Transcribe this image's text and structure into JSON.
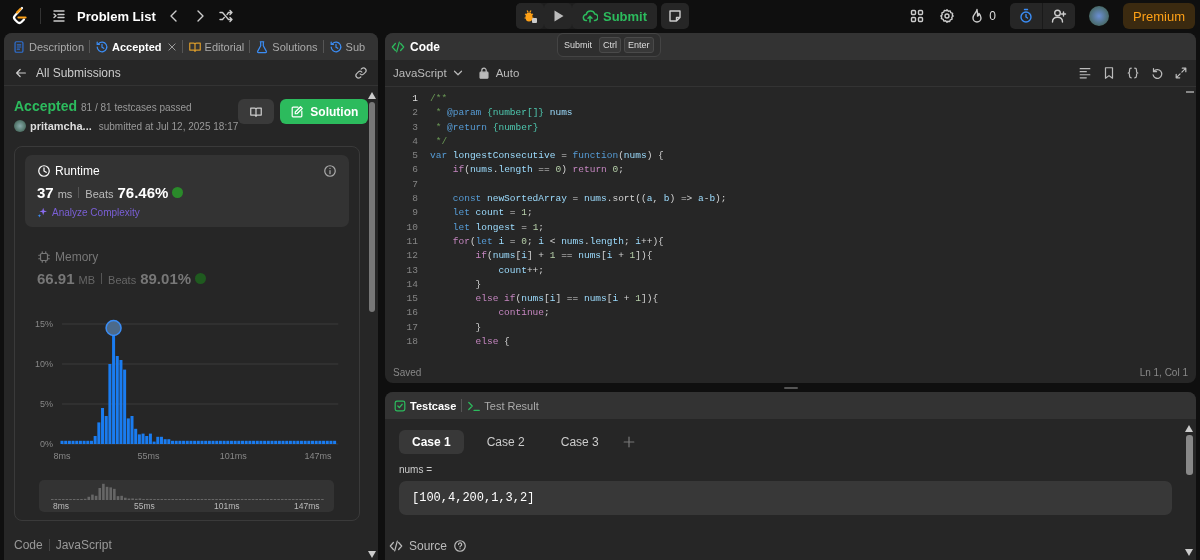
{
  "top_bar": {
    "problem_list": "Problem List",
    "submit": "Submit",
    "tooltip": {
      "label": "Submit",
      "keys": [
        "Ctrl",
        "Enter"
      ]
    },
    "streak": "0",
    "premium": "Premium"
  },
  "left_panel": {
    "tabs": [
      {
        "label": "Description",
        "kind": "document",
        "selected": false,
        "closable": false
      },
      {
        "label": "Accepted",
        "kind": "history",
        "selected": true,
        "closable": true
      },
      {
        "label": "Editorial",
        "kind": "book",
        "selected": false,
        "closable": false
      },
      {
        "label": "Solutions",
        "kind": "flask",
        "selected": false,
        "closable": false
      },
      {
        "label": "Sub",
        "kind": "history",
        "selected": false,
        "closable": false
      }
    ],
    "back_link": "All Submissions",
    "submission": {
      "status": "Accepted",
      "testcases": "81 / 81 testcases passed",
      "user": "pritamcha...",
      "submitted": "submitted at Jul 12, 2025 18:17",
      "solution_button": "Solution"
    },
    "metrics": [
      {
        "kind": "runtime",
        "title": "Runtime",
        "value": "37",
        "unit": "ms",
        "beats_label": "Beats",
        "beats": "76.46%",
        "link": "Analyze Complexity",
        "selected": true
      },
      {
        "kind": "memory",
        "title": "Memory",
        "value": "66.91",
        "unit": "MB",
        "beats_label": "Beats",
        "beats": "89.01%",
        "selected": false
      }
    ],
    "chart_data": {
      "type": "bar",
      "x": [
        8,
        10,
        12,
        14,
        16,
        18,
        20,
        22,
        24,
        26,
        28,
        30,
        32,
        34,
        36,
        38,
        40,
        42,
        44,
        46,
        48,
        50,
        52,
        54,
        56,
        58,
        60,
        62,
        64,
        66,
        68,
        70,
        72,
        74,
        76,
        78,
        80,
        82,
        84,
        86,
        88,
        90,
        92,
        94,
        96,
        98,
        100,
        102,
        104,
        106,
        108,
        110,
        112,
        114,
        116,
        118,
        120,
        122,
        124,
        126,
        128,
        130,
        132,
        134,
        136,
        138,
        140,
        142,
        144,
        146,
        148,
        150,
        152,
        154,
        156
      ],
      "values": [
        0.4,
        0.4,
        0.4,
        0.4,
        0.4,
        0.4,
        0.4,
        0.4,
        0.4,
        1.0,
        2.7,
        4.5,
        3.5,
        10,
        13.5,
        11,
        10.5,
        9.3,
        3.2,
        3.5,
        1.9,
        1.2,
        1.3,
        1.0,
        1.3,
        0.3,
        0.9,
        0.9,
        0.6,
        0.6,
        0.4,
        0.4,
        0.4,
        0.4,
        0.4,
        0.4,
        0.4,
        0.4,
        0.4,
        0.4,
        0.4,
        0.4,
        0.4,
        0.4,
        0.4,
        0.4,
        0.4,
        0.4,
        0.4,
        0.4,
        0.4,
        0.4,
        0.4,
        0.4,
        0.4,
        0.4,
        0.4,
        0.4,
        0.4,
        0.4,
        0.4,
        0.4,
        0.4,
        0.4,
        0.4,
        0.4,
        0.4,
        0.4,
        0.4,
        0.4,
        0.4,
        0.4,
        0.4,
        0.4,
        0.4
      ],
      "ylim": [
        0,
        15
      ],
      "xlim": [
        8,
        158
      ],
      "yticks": [
        {
          "value": 0,
          "label": "0%"
        },
        {
          "value": 5,
          "label": "5%"
        },
        {
          "value": 10,
          "label": "10%"
        },
        {
          "value": 15,
          "label": "15%"
        }
      ],
      "xticks": [
        {
          "value": 8,
          "label": "8ms"
        },
        {
          "value": 55,
          "label": "55ms"
        },
        {
          "value": 101,
          "label": "101ms"
        },
        {
          "value": 147,
          "label": "147ms"
        }
      ]
    },
    "overview_labels": [
      "8ms",
      "55ms",
      "101ms",
      "147ms"
    ],
    "footer": [
      "Code",
      "JavaScript"
    ]
  },
  "editor": {
    "title": "Code",
    "language": "JavaScript",
    "mode": "Auto",
    "lines": [
      {
        "no": "1",
        "tokens": [
          {
            "text": "/**",
            "kind": "comment"
          }
        ]
      },
      {
        "no": "2",
        "tokens": [
          {
            "text": " * ",
            "kind": "comment"
          },
          {
            "text": "@param",
            "kind": "doctag"
          },
          {
            "text": " {number[]}",
            "kind": "doctype"
          },
          {
            "text": " nums",
            "kind": "ident"
          }
        ]
      },
      {
        "no": "3",
        "tokens": [
          {
            "text": " * ",
            "kind": "comment"
          },
          {
            "text": "@return",
            "kind": "doctag"
          },
          {
            "text": " {number}",
            "kind": "doctype"
          }
        ]
      },
      {
        "no": "4",
        "tokens": [
          {
            "text": " */",
            "kind": "comment"
          }
        ]
      },
      {
        "no": "5",
        "tokens": [
          {
            "text": "var",
            "kind": "keyword"
          },
          {
            "text": " longestConsecutive",
            "kind": "ident"
          },
          {
            "text": " = ",
            "kind": "plain"
          },
          {
            "text": "function",
            "kind": "keyword"
          },
          {
            "text": "(",
            "kind": "plain"
          },
          {
            "text": "nums",
            "kind": "ident"
          },
          {
            "text": ") {",
            "kind": "plain"
          }
        ]
      },
      {
        "no": "6",
        "tokens": [
          {
            "text": "    if",
            "kind": "control"
          },
          {
            "text": "(",
            "kind": "plain"
          },
          {
            "text": "nums",
            "kind": "ident"
          },
          {
            "text": ".",
            "kind": "plain"
          },
          {
            "text": "length",
            "kind": "ident"
          },
          {
            "text": " == ",
            "kind": "plain"
          },
          {
            "text": "0",
            "kind": "number"
          },
          {
            "text": ") ",
            "kind": "plain"
          },
          {
            "text": "return",
            "kind": "control"
          },
          {
            "text": " 0",
            "kind": "number"
          },
          {
            "text": ";",
            "kind": "plain"
          }
        ]
      },
      {
        "no": "7"
      },
      {
        "no": "8",
        "tokens": [
          {
            "text": "    const",
            "kind": "keyword"
          },
          {
            "text": " newSortedArray",
            "kind": "ident"
          },
          {
            "text": " = ",
            "kind": "plain"
          },
          {
            "text": "nums",
            "kind": "ident"
          },
          {
            "text": ".sort((",
            "kind": "plain"
          },
          {
            "text": "a",
            "kind": "ident"
          },
          {
            "text": ", ",
            "kind": "plain"
          },
          {
            "text": "b",
            "kind": "ident"
          },
          {
            "text": ") => ",
            "kind": "plain"
          },
          {
            "text": "a",
            "kind": "ident"
          },
          {
            "text": "-",
            "kind": "plain"
          },
          {
            "text": "b",
            "kind": "ident"
          },
          {
            "text": ");",
            "kind": "plain"
          }
        ]
      },
      {
        "no": "9",
        "tokens": [
          {
            "text": "    let",
            "kind": "keyword"
          },
          {
            "text": " count",
            "kind": "ident"
          },
          {
            "text": " = ",
            "kind": "plain"
          },
          {
            "text": "1",
            "kind": "number"
          },
          {
            "text": ";",
            "kind": "plain"
          }
        ]
      },
      {
        "no": "10",
        "tokens": [
          {
            "text": "    let",
            "kind": "keyword"
          },
          {
            "text": " longest",
            "kind": "ident"
          },
          {
            "text": " = ",
            "kind": "plain"
          },
          {
            "text": "1",
            "kind": "number"
          },
          {
            "text": ";",
            "kind": "plain"
          }
        ]
      },
      {
        "no": "11",
        "tokens": [
          {
            "text": "    for",
            "kind": "control"
          },
          {
            "text": "(",
            "kind": "plain"
          },
          {
            "text": "let",
            "kind": "keyword"
          },
          {
            "text": " i",
            "kind": "ident"
          },
          {
            "text": " = ",
            "kind": "plain"
          },
          {
            "text": "0",
            "kind": "number"
          },
          {
            "text": "; ",
            "kind": "plain"
          },
          {
            "text": "i",
            "kind": "ident"
          },
          {
            "text": " < ",
            "kind": "plain"
          },
          {
            "text": "nums",
            "kind": "ident"
          },
          {
            "text": ".",
            "kind": "plain"
          },
          {
            "text": "length",
            "kind": "ident"
          },
          {
            "text": "; ",
            "kind": "plain"
          },
          {
            "text": "i",
            "kind": "ident"
          },
          {
            "text": "++){",
            "kind": "plain"
          }
        ]
      },
      {
        "no": "12",
        "tokens": [
          {
            "text": "        if",
            "kind": "control"
          },
          {
            "text": "(",
            "kind": "plain"
          },
          {
            "text": "nums",
            "kind": "ident"
          },
          {
            "text": "[",
            "kind": "plain"
          },
          {
            "text": "i",
            "kind": "ident"
          },
          {
            "text": "] + ",
            "kind": "plain"
          },
          {
            "text": "1",
            "kind": "number"
          },
          {
            "text": " == ",
            "kind": "plain"
          },
          {
            "text": "nums",
            "kind": "ident"
          },
          {
            "text": "[",
            "kind": "plain"
          },
          {
            "text": "i",
            "kind": "ident"
          },
          {
            "text": " + ",
            "kind": "plain"
          },
          {
            "text": "1",
            "kind": "number"
          },
          {
            "text": "]){",
            "kind": "plain"
          }
        ]
      },
      {
        "no": "13",
        "tokens": [
          {
            "text": "            count",
            "kind": "ident"
          },
          {
            "text": "++;",
            "kind": "plain"
          }
        ]
      },
      {
        "no": "14",
        "tokens": [
          {
            "text": "        }",
            "kind": "plain"
          }
        ]
      },
      {
        "no": "15",
        "tokens": [
          {
            "text": "        else if",
            "kind": "control"
          },
          {
            "text": "(",
            "kind": "plain"
          },
          {
            "text": "nums",
            "kind": "ident"
          },
          {
            "text": "[",
            "kind": "plain"
          },
          {
            "text": "i",
            "kind": "ident"
          },
          {
            "text": "] == ",
            "kind": "plain"
          },
          {
            "text": "nums",
            "kind": "ident"
          },
          {
            "text": "[",
            "kind": "plain"
          },
          {
            "text": "i",
            "kind": "ident"
          },
          {
            "text": " + ",
            "kind": "plain"
          },
          {
            "text": "1",
            "kind": "number"
          },
          {
            "text": "]){",
            "kind": "plain"
          }
        ]
      },
      {
        "no": "16",
        "tokens": [
          {
            "text": "            continue",
            "kind": "control"
          },
          {
            "text": ";",
            "kind": "plain"
          }
        ]
      },
      {
        "no": "17",
        "tokens": [
          {
            "text": "        }",
            "kind": "plain"
          }
        ]
      },
      {
        "no": "18",
        "tokens": [
          {
            "text": "        else",
            "kind": "control"
          },
          {
            "text": " {",
            "kind": "plain"
          }
        ]
      }
    ],
    "status": "Saved",
    "cursor": "Ln 1, Col 1"
  },
  "console": {
    "tabs": [
      {
        "label": "Testcase",
        "kind": "check",
        "selected": true
      },
      {
        "label": "Test Result",
        "kind": "terminal",
        "selected": false
      }
    ],
    "cases": [
      {
        "label": "Case 1",
        "selected": true
      },
      {
        "label": "Case 2",
        "selected": false
      },
      {
        "label": "Case 3",
        "selected": false
      }
    ],
    "param_label": "nums =",
    "param_value": "[100,4,200,1,3,2]",
    "footer": "Source"
  }
}
